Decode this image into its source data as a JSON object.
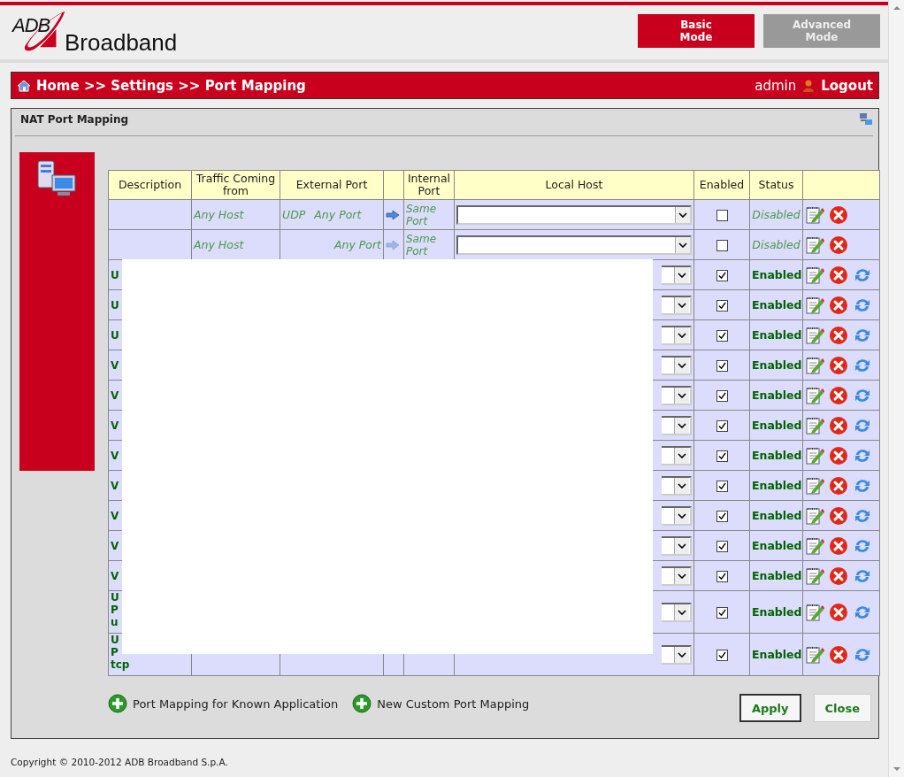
{
  "brand": {
    "logo_mark": "ADB",
    "name": "Broadband"
  },
  "modes": [
    {
      "label": "Basic\nMode",
      "selected": true
    },
    {
      "label": "Advanced\nMode",
      "selected": false
    }
  ],
  "breadcrumb": "Home >> Settings >> Port Mapping",
  "user": "admin",
  "logout": "Logout",
  "panel": {
    "title": "NAT Port Mapping"
  },
  "table": {
    "columns": [
      "Description",
      "Traffic Coming from",
      "External Port",
      "",
      "Internal Port",
      "Local Host",
      "Enabled",
      "Status",
      ""
    ],
    "rows": [
      {
        "description": "",
        "traffic_from": "Any Host",
        "protocol": "UDP",
        "external_port": "Any Port",
        "internal_port": "Same Port",
        "enabled": false,
        "status": "Disabled"
      },
      {
        "description": "",
        "traffic_from": "Any Host",
        "external_port": "Any Port",
        "internal_port": "Same Port",
        "enabled": false,
        "status": "Disabled"
      },
      {
        "description": "U",
        "enabled": true,
        "status": "Enabled"
      },
      {
        "description": "U",
        "enabled": true,
        "status": "Enabled"
      },
      {
        "description": "U",
        "enabled": true,
        "status": "Enabled"
      },
      {
        "description": "V",
        "enabled": true,
        "status": "Enabled"
      },
      {
        "description": "V",
        "enabled": true,
        "status": "Enabled"
      },
      {
        "description": "V",
        "enabled": true,
        "status": "Enabled"
      },
      {
        "description": "V",
        "enabled": true,
        "status": "Enabled"
      },
      {
        "description": "V",
        "enabled": true,
        "status": "Enabled"
      },
      {
        "description": "V",
        "enabled": true,
        "status": "Enabled"
      },
      {
        "description": "V",
        "enabled": true,
        "status": "Enabled"
      },
      {
        "description": "V",
        "enabled": true,
        "status": "Enabled"
      },
      {
        "description": "U\nP\nu",
        "enabled": true,
        "status": "Enabled"
      },
      {
        "description": "U\nP\ntcp",
        "enabled": true,
        "status": "Enabled"
      }
    ]
  },
  "links": [
    "Port Mapping for Known Application",
    "New Custom Port Mapping"
  ],
  "buttons": [
    "Apply",
    "Close"
  ],
  "copyright": "Copyright © 2010-2012 ADB Broadband S.p.A."
}
